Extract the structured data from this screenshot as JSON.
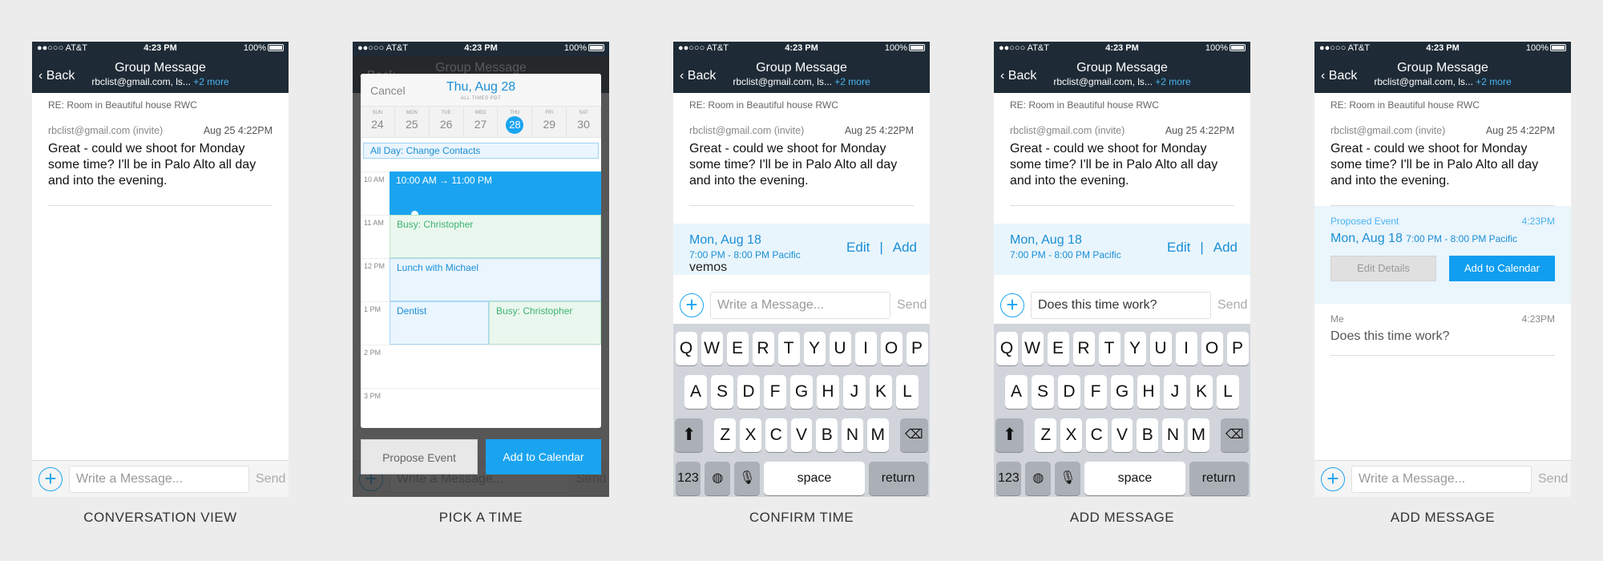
{
  "status": {
    "carrier": "●●○○○ AT&T",
    "time": "4:23 PM",
    "battery": "100%"
  },
  "nav": {
    "back": "Back",
    "title": "Group Message",
    "subtitle": "rbclist@gmail.com, ls...",
    "more": "+2 more"
  },
  "thread": {
    "subject": "RE: Room in Beautiful house RWC",
    "sender": "rbclist@gmail.com (invite)",
    "date": "Aug 25 4:22PM",
    "body": "Great - could we shoot for Monday some time? I'll be in Palo Alto all day and into the evening."
  },
  "composer": {
    "placeholder": "Write a Message...",
    "send": "Send",
    "typed": "Does this time work?"
  },
  "event": {
    "date": "Mon, Aug 18",
    "time": "7:00 PM - 8:00 PM Pacific",
    "edit": "Edit",
    "sep": "|",
    "add": "Add"
  },
  "keyboard": {
    "row1": [
      "Q",
      "W",
      "E",
      "R",
      "T",
      "Y",
      "U",
      "I",
      "O",
      "P"
    ],
    "row2": [
      "A",
      "S",
      "D",
      "F",
      "G",
      "H",
      "J",
      "K",
      "L"
    ],
    "row3": [
      "Z",
      "X",
      "C",
      "V",
      "B",
      "N",
      "M"
    ],
    "num": "123",
    "space": "space",
    "return": "return"
  },
  "calendar": {
    "cancel": "Cancel",
    "title": "Thu, Aug 28",
    "subtitle": "ALL TIMES PDT",
    "days": [
      {
        "name": "SUN",
        "num": "24"
      },
      {
        "name": "MON",
        "num": "25"
      },
      {
        "name": "TUE",
        "num": "26"
      },
      {
        "name": "WED",
        "num": "27"
      },
      {
        "name": "THU",
        "num": "28"
      },
      {
        "name": "FRI",
        "num": "29"
      },
      {
        "name": "SAT",
        "num": "30"
      }
    ],
    "allday": "All Day: Change Contacts",
    "hours": [
      "10 AM",
      "11 AM",
      "12 PM",
      "1 PM",
      "2 PM",
      "3 PM"
    ],
    "selected": "10:00 AM → 11:00 PM",
    "busy1": "Busy: Christopher",
    "lunch": "Lunch with Michael",
    "dentist": "Dentist",
    "busy2": "Busy: Christopher",
    "propose": "Propose Event",
    "add_to_calendar": "Add to Calendar"
  },
  "proposed": {
    "label": "Proposed Event",
    "time_stamp": "4:23PM",
    "date": "Mon, Aug 18",
    "time": "7:00 PM - 8:00 PM Pacific",
    "edit_details": "Edit Details",
    "add_to_calendar": "Add to Calendar"
  },
  "me_message": {
    "sender": "Me",
    "time": "4:23PM",
    "body": "Does this time work?"
  },
  "captions": [
    "CONVERSATION VIEW",
    "PICK A TIME",
    "CONFIRM TIME",
    "ADD MESSAGE",
    "ADD MESSAGE"
  ]
}
